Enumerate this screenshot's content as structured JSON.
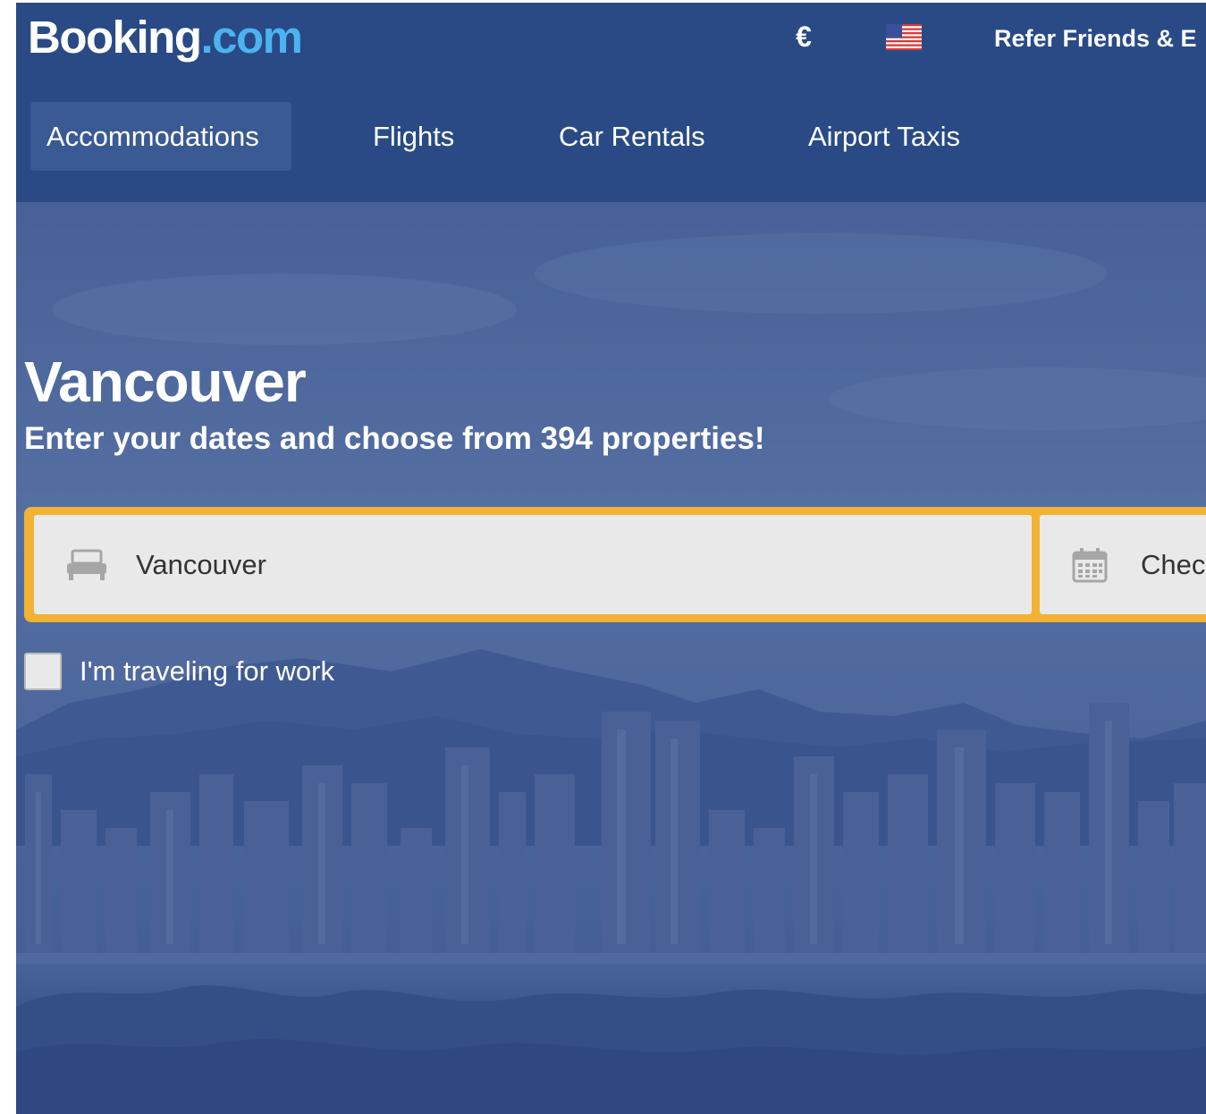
{
  "colors": {
    "header_bg": "#294a85",
    "active_tab_bg": "#3a5a93",
    "logo_tld": "#4cb3f0",
    "search_border": "#f2b233",
    "field_bg": "#e9e9e9"
  },
  "header": {
    "logo": {
      "brand": "Booking",
      "tld": ".com"
    },
    "currency": "€",
    "language_icon": "us-flag-icon",
    "refer_link": "Refer Friends & E"
  },
  "nav": {
    "tabs": [
      {
        "label": "Accommodations",
        "active": true
      },
      {
        "label": "Flights",
        "active": false
      },
      {
        "label": "Car Rentals",
        "active": false
      },
      {
        "label": "Airport Taxis",
        "active": false
      }
    ]
  },
  "hero": {
    "title": "Vancouver",
    "subtitle": "Enter your dates and choose from 394 properties!",
    "background": "vancouver-skyline-photo"
  },
  "search": {
    "destination": {
      "icon": "bed-icon",
      "value": "Vancouver"
    },
    "checkin": {
      "icon": "calendar-icon",
      "label": "Chec"
    }
  },
  "work_travel": {
    "checked": false,
    "label": "I'm traveling for work"
  }
}
